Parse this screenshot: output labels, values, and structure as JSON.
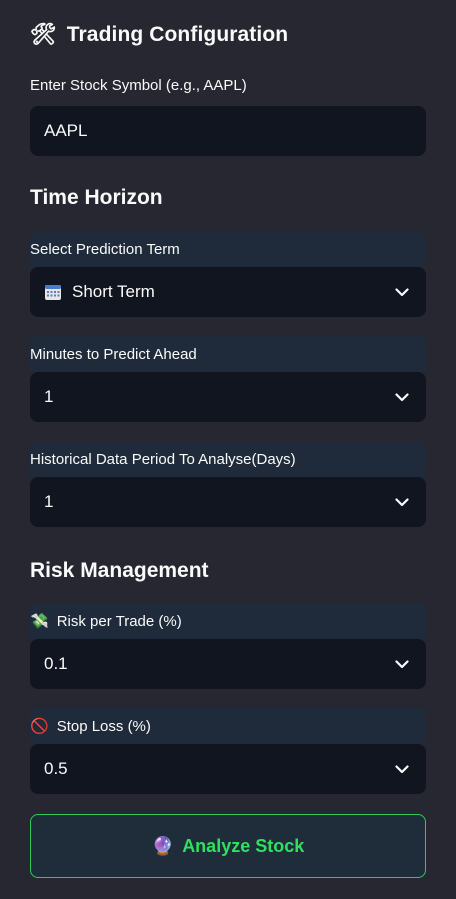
{
  "title": {
    "icon": "hammer-and-wrench-icon",
    "glyph": "🛠",
    "text": "Trading Configuration"
  },
  "stock_symbol": {
    "label": "Enter Stock Symbol (e.g., AAPL)",
    "value": "AAPL"
  },
  "time_horizon": {
    "heading": "Time Horizon",
    "prediction_term": {
      "label": "Select Prediction Term",
      "value": "Short Term",
      "icon": "calendar-icon"
    },
    "minutes_ahead": {
      "label": "Minutes to Predict Ahead",
      "value": "1"
    },
    "history_period": {
      "label": "Historical Data Period To Analyse(Days)",
      "value": "1"
    }
  },
  "risk_management": {
    "heading": "Risk Management",
    "risk_per_trade": {
      "label": "Risk per Trade (%)",
      "value": "0.1",
      "icon": "money-with-wings-icon",
      "glyph": "💸"
    },
    "stop_loss": {
      "label": "Stop Loss (%)",
      "value": "0.5",
      "icon": "no-entry-icon",
      "glyph": "🚫"
    }
  },
  "analyze_button": {
    "label": "Analyze Stock",
    "icon": "crystal-ball-icon",
    "glyph": "🔮"
  },
  "colors": {
    "background": "#262730",
    "input": "#111520",
    "label_band": "#1F2B3A",
    "accent_green": "#30E060"
  }
}
